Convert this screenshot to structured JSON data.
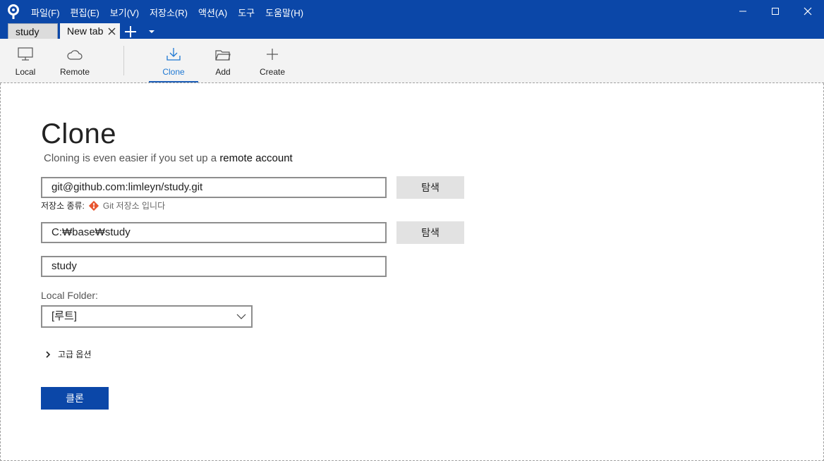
{
  "titlebar": {
    "menu": [
      "파일(F)",
      "편집(E)",
      "보기(V)",
      "저장소(R)",
      "액션(A)",
      "도구",
      "도움말(H)"
    ]
  },
  "tabs": [
    {
      "label": "study"
    },
    {
      "label": "New tab"
    }
  ],
  "toolbar": {
    "local": "Local",
    "remote": "Remote",
    "clone": "Clone",
    "add": "Add",
    "create": "Create"
  },
  "clone": {
    "title": "Clone",
    "subtitle_prefix": "Cloning is even easier if you set up a ",
    "subtitle_link": "remote account",
    "source_url": "git@github.com:limleyn/study.git",
    "browse_label": "탐색",
    "repo_type_label": "저장소 종류:",
    "repo_type_value": "Git 저장소 입니다",
    "dest_path": "C:₩base₩study",
    "name": "study",
    "local_folder_label": "Local Folder:",
    "local_folder_value": "[루트]",
    "advanced_label": "고급 옵션",
    "clone_button": "클론"
  },
  "colors": {
    "brand": "#0b47a8",
    "accent": "#1e78d3",
    "git": "#e8552f"
  },
  "icons": [
    "sourcetree-logo-icon",
    "minimize-icon",
    "maximize-icon",
    "close-icon",
    "monitor-icon",
    "cloud-icon",
    "download-icon",
    "folder-icon",
    "plus-icon",
    "git-icon",
    "chevron-down-icon",
    "chevron-right-icon"
  ]
}
